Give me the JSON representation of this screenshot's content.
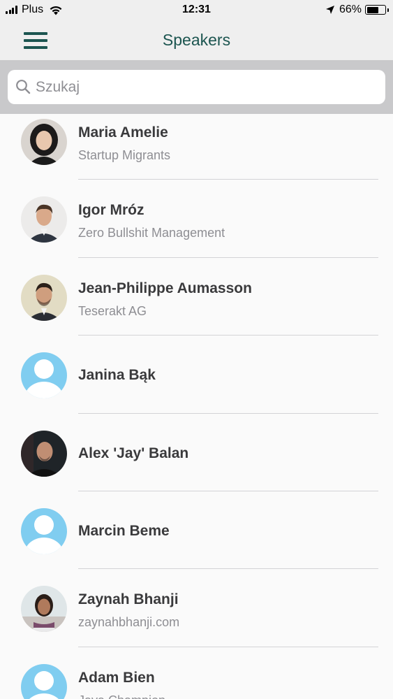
{
  "status_bar": {
    "carrier": "Plus",
    "time": "12:31",
    "battery_percent": "66%",
    "battery_level": 0.66
  },
  "nav": {
    "title": "Speakers",
    "menu_icon": "hamburger-menu-icon",
    "title_color": "#1c5550"
  },
  "search": {
    "placeholder": "Szukaj",
    "value": ""
  },
  "speakers": [
    {
      "name": "Maria Amelie",
      "subtitle": "Startup Migrants",
      "avatar": "photo"
    },
    {
      "name": "Igor Mróz",
      "subtitle": "Zero Bullshit Management",
      "avatar": "photo"
    },
    {
      "name": "Jean-Philippe Aumasson",
      "subtitle": "Teserakt AG",
      "avatar": "photo"
    },
    {
      "name": "Janina Bąk",
      "subtitle": "",
      "avatar": "placeholder"
    },
    {
      "name": "Alex 'Jay' Balan",
      "subtitle": "",
      "avatar": "photo"
    },
    {
      "name": "Marcin Beme",
      "subtitle": "",
      "avatar": "placeholder"
    },
    {
      "name": "Zaynah Bhanji",
      "subtitle": "zaynahbhanji.com",
      "avatar": "photo"
    },
    {
      "name": "Adam Bien",
      "subtitle": "Java Champion",
      "avatar": "placeholder"
    }
  ]
}
